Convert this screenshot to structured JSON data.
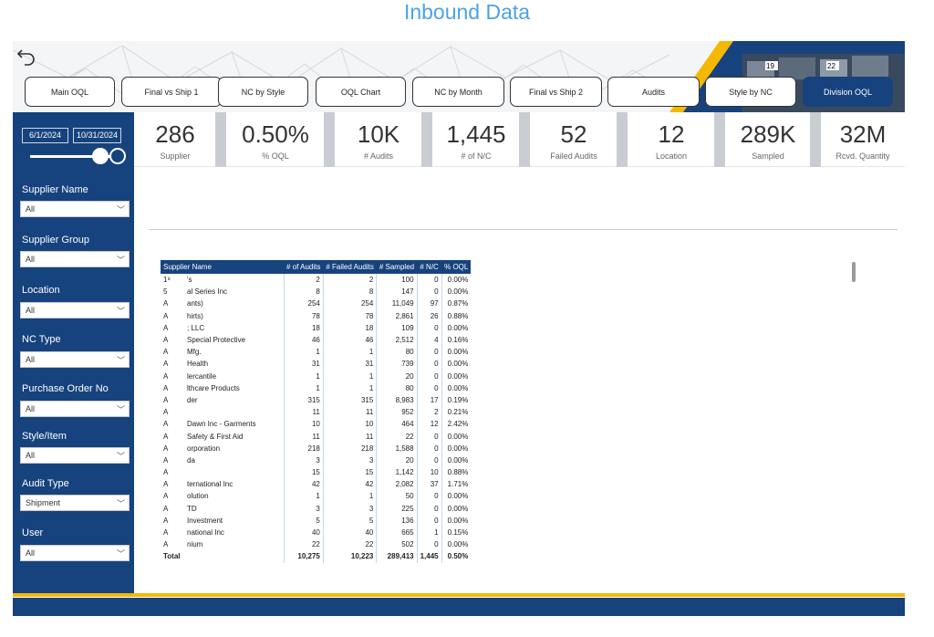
{
  "page_title": "Inbound Data",
  "nav": {
    "buttons": [
      {
        "label": "Main OQL",
        "active": false
      },
      {
        "label": "Final vs Ship 1",
        "active": false
      },
      {
        "label": "NC by Style",
        "active": false
      },
      {
        "label": "OQL Chart",
        "active": false
      },
      {
        "label": "NC by Month",
        "active": false
      },
      {
        "label": "Final vs Ship 2",
        "active": false
      },
      {
        "label": "Audits",
        "active": false
      },
      {
        "label": "Style by NC",
        "active": false
      },
      {
        "label": "Division OQL",
        "active": true
      }
    ]
  },
  "banner": {
    "badge_19": "19",
    "badge_22": "22"
  },
  "date_range": {
    "start": "6/1/2024",
    "end": "10/31/2024"
  },
  "filters": [
    {
      "label": "Supplier Name",
      "value": "All"
    },
    {
      "label": "Supplier Group",
      "value": "All"
    },
    {
      "label": "Location",
      "value": "All"
    },
    {
      "label": "NC Type",
      "value": "All"
    },
    {
      "label": "Purchase Order No",
      "value": "All"
    },
    {
      "label": "Style/Item",
      "value": "All"
    },
    {
      "label": "Audit Type",
      "value": "Shipment"
    },
    {
      "label": "User",
      "value": "All"
    }
  ],
  "kpis": [
    {
      "value": "286",
      "label": "Supplier"
    },
    {
      "value": "0.50%",
      "label": "% OQL"
    },
    {
      "value": "10K",
      "label": "# Audits"
    },
    {
      "value": "1,445",
      "label": "# of N/C"
    },
    {
      "value": "52",
      "label": "Failed Audits"
    },
    {
      "value": "12",
      "label": "Location"
    },
    {
      "value": "289K",
      "label": "Sampled"
    },
    {
      "value": "32M",
      "label": "Rcvd. Quantity"
    }
  ],
  "table": {
    "columns": [
      "Supplier Name",
      "# of Audits",
      "# Failed Audits",
      "# Sampled",
      "# N/C",
      "% OQL"
    ],
    "rows": [
      [
        "1⁸",
        "'s",
        "2",
        "2",
        "100",
        "0",
        "0.00%"
      ],
      [
        "5",
        "al Series Inc",
        "8",
        "8",
        "147",
        "0",
        "0.00%"
      ],
      [
        "A",
        "ants)",
        "254",
        "254",
        "11,049",
        "97",
        "0.87%"
      ],
      [
        "A",
        "hirts)",
        "78",
        "78",
        "2,861",
        "26",
        "0.88%"
      ],
      [
        "A",
        "; LLC",
        "18",
        "18",
        "109",
        "0",
        "0.00%"
      ],
      [
        "A",
        "Special Protective",
        "46",
        "46",
        "2,512",
        "4",
        "0.16%"
      ],
      [
        "A",
        "Mfg.",
        "1",
        "1",
        "80",
        "0",
        "0.00%"
      ],
      [
        "A",
        "Health",
        "31",
        "31",
        "739",
        "0",
        "0.00%"
      ],
      [
        "A",
        "lercantile",
        "1",
        "1",
        "20",
        "0",
        "0.00%"
      ],
      [
        "A",
        "lthcare Products",
        "1",
        "1",
        "80",
        "0",
        "0.00%"
      ],
      [
        "A",
        "der",
        "315",
        "315",
        "8,983",
        "17",
        "0.19%"
      ],
      [
        "A",
        "",
        "11",
        "11",
        "952",
        "2",
        "0.21%"
      ],
      [
        "A",
        "Dawn Inc - Garments",
        "10",
        "10",
        "464",
        "12",
        "2.42%"
      ],
      [
        "A",
        "Safety & First Aid",
        "11",
        "11",
        "22",
        "0",
        "0.00%"
      ],
      [
        "A",
        "orporation",
        "218",
        "218",
        "1,588",
        "0",
        "0.00%"
      ],
      [
        "A",
        "da",
        "3",
        "3",
        "20",
        "0",
        "0.00%"
      ],
      [
        "A",
        "",
        "15",
        "15",
        "1,142",
        "10",
        "0.88%"
      ],
      [
        "A",
        "ternational Inc",
        "42",
        "42",
        "2,082",
        "37",
        "1.71%"
      ],
      [
        "A",
        "olution",
        "1",
        "1",
        "50",
        "0",
        "0.00%"
      ],
      [
        "A",
        "TD",
        "3",
        "3",
        "225",
        "0",
        "0.00%"
      ],
      [
        "A",
        "Investment",
        "5",
        "5",
        "136",
        "0",
        "0.00%"
      ],
      [
        "A",
        "national Inc",
        "40",
        "40",
        "665",
        "1",
        "0.15%"
      ],
      [
        "A",
        "nium",
        "22",
        "22",
        "502",
        "0",
        "0.00%"
      ]
    ],
    "total": [
      "Total",
      "10,275",
      "10,223",
      "289,413",
      "1,445",
      "0.50%"
    ]
  },
  "colors": {
    "navy": "#16437e",
    "gold": "#f5b800",
    "title_blue": "#4aa3e6"
  }
}
